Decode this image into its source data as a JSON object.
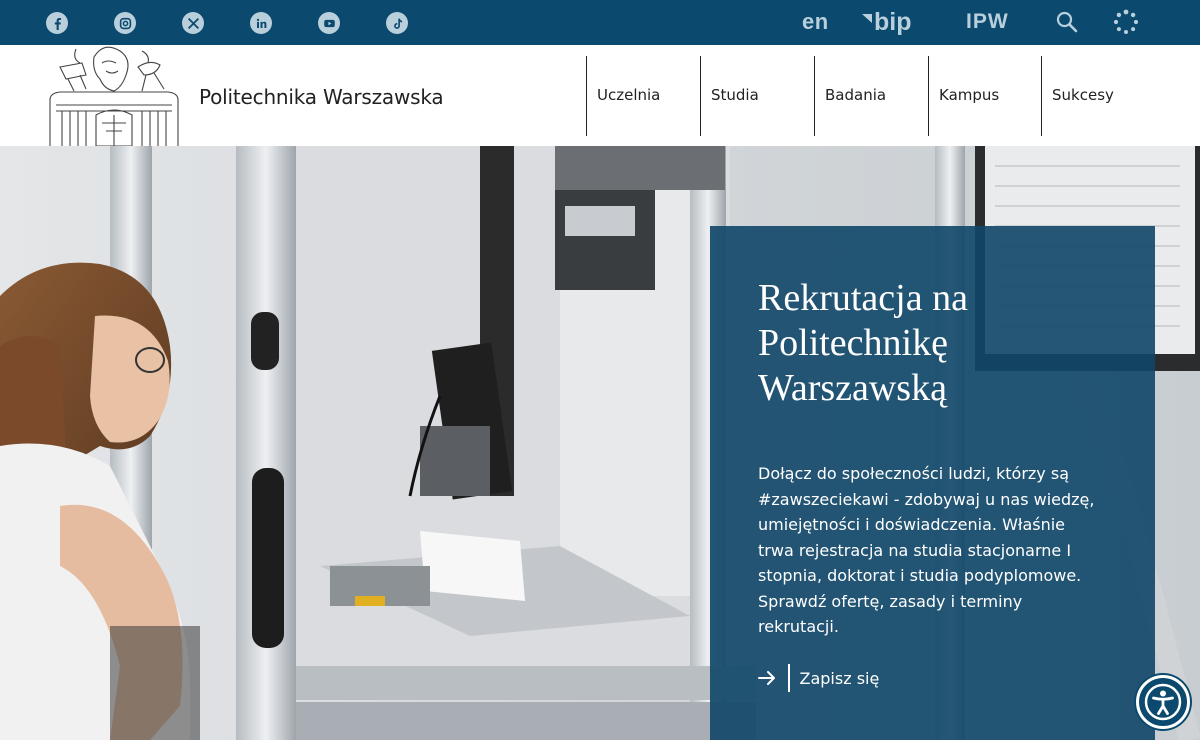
{
  "topbar": {
    "social": [
      {
        "name": "facebook",
        "icon": "facebook-icon"
      },
      {
        "name": "instagram",
        "icon": "instagram-icon"
      },
      {
        "name": "x",
        "icon": "x-icon"
      },
      {
        "name": "linkedin",
        "icon": "linkedin-icon"
      },
      {
        "name": "youtube",
        "icon": "youtube-icon"
      },
      {
        "name": "tiktok",
        "icon": "tiktok-icon"
      }
    ],
    "lang_label": "en",
    "bip_label": "bip",
    "ipw_label": "IPW",
    "search_icon": "search-icon",
    "loader_icon": "dots-spinner-icon",
    "bg_color": "#0b4a6e",
    "icon_color": "#b9cfdc"
  },
  "header": {
    "logo_text": "Politechnika Warszawska",
    "logo_icon": "university-emblem-icon",
    "nav": [
      "Uczelnia",
      "Studia",
      "Badania",
      "Kampus",
      "Sukcesy"
    ]
  },
  "hero": {
    "title": "Rekrutacja na Politechnikę Warszawską",
    "body": "Dołącz do społeczności ludzi, którzy są #zawszeciekawi - zdobywaj u nas wiedzę, umiejętności i doświadczenia. Właśnie trwa rejestracja na studia stacjonarne I stopnia, doktorat i studia podyplomowe. Sprawdź ofertę, zasady i terminy rekrutacji.",
    "cta_label": "Zapisz się",
    "cta_icon": "arrow-right-icon",
    "card_color": "#104668"
  },
  "accessibility": {
    "icon": "accessibility-icon"
  }
}
